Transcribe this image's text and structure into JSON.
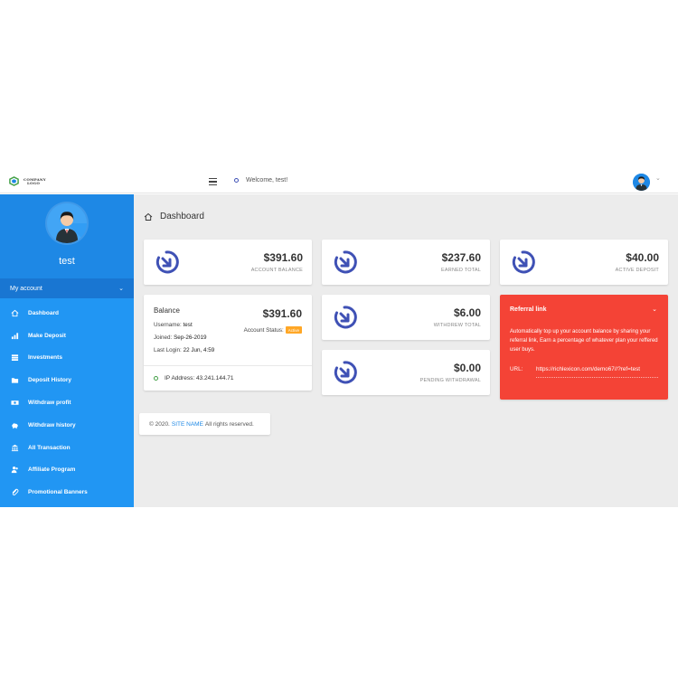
{
  "header": {
    "logo_line1": "COMPANY",
    "logo_line2": "LOGO",
    "welcome": "Welcome, test!"
  },
  "sidebar": {
    "username": "test",
    "section_label": "My account",
    "items": [
      {
        "label": "Dashboard",
        "icon": "home-icon"
      },
      {
        "label": "Make Deposit",
        "icon": "bar-chart-icon"
      },
      {
        "label": "Investments",
        "icon": "database-icon"
      },
      {
        "label": "Deposit History",
        "icon": "folder-icon"
      },
      {
        "label": "Withdraw profit",
        "icon": "cash-icon"
      },
      {
        "label": "Withdraw history",
        "icon": "piggy-bank-icon"
      },
      {
        "label": "All Transaction",
        "icon": "bank-icon"
      },
      {
        "label": "Affiliate Program",
        "icon": "users-icon"
      },
      {
        "label": "Promotional Banners",
        "icon": "paperclip-icon"
      }
    ]
  },
  "page": {
    "title": "Dashboard"
  },
  "stats": {
    "account_balance": {
      "amount": "$391.60",
      "label": "ACCOUNT BALANCE"
    },
    "earned_total": {
      "amount": "$237.60",
      "label": "EARNED TOTAL"
    },
    "active_deposit": {
      "amount": "$40.00",
      "label": "ACTIVE DEPOSIT"
    },
    "withdrew_total": {
      "amount": "$6.00",
      "label": "WITHDREW TOTAL"
    },
    "pending_withdrawal": {
      "amount": "$0.00",
      "label": "PENDING WITHDRAWAL"
    }
  },
  "balance": {
    "title": "Balance",
    "amount": "$391.60",
    "username_label": "Username:",
    "username": "test",
    "joined_label": "Joined:",
    "joined": "Sep-26-2019",
    "last_login_label": "Last Login:",
    "last_login": "22 Jun, 4:59",
    "account_status_label": "Account Status:",
    "account_status": "Active",
    "ip_label": "IP Address:",
    "ip": "43.241.144.71"
  },
  "referral": {
    "title": "Referral link",
    "description": "Automatically top up your account balance by sharing your referral link, Earn a percentage of whatever plan your reffered user buys.",
    "url_label": "URL:",
    "url": "https://richlexicon.com/demo67//?ref=test"
  },
  "footer": {
    "prefix": "© 2020.",
    "site_name": "SITE NAME",
    "suffix": "All rights reserved."
  },
  "colors": {
    "sidebar": "#2196f3",
    "sidebar_dark": "#1976d2",
    "icon_accent": "#3f51b5",
    "referral": "#f44336",
    "badge": "#ffa726"
  }
}
